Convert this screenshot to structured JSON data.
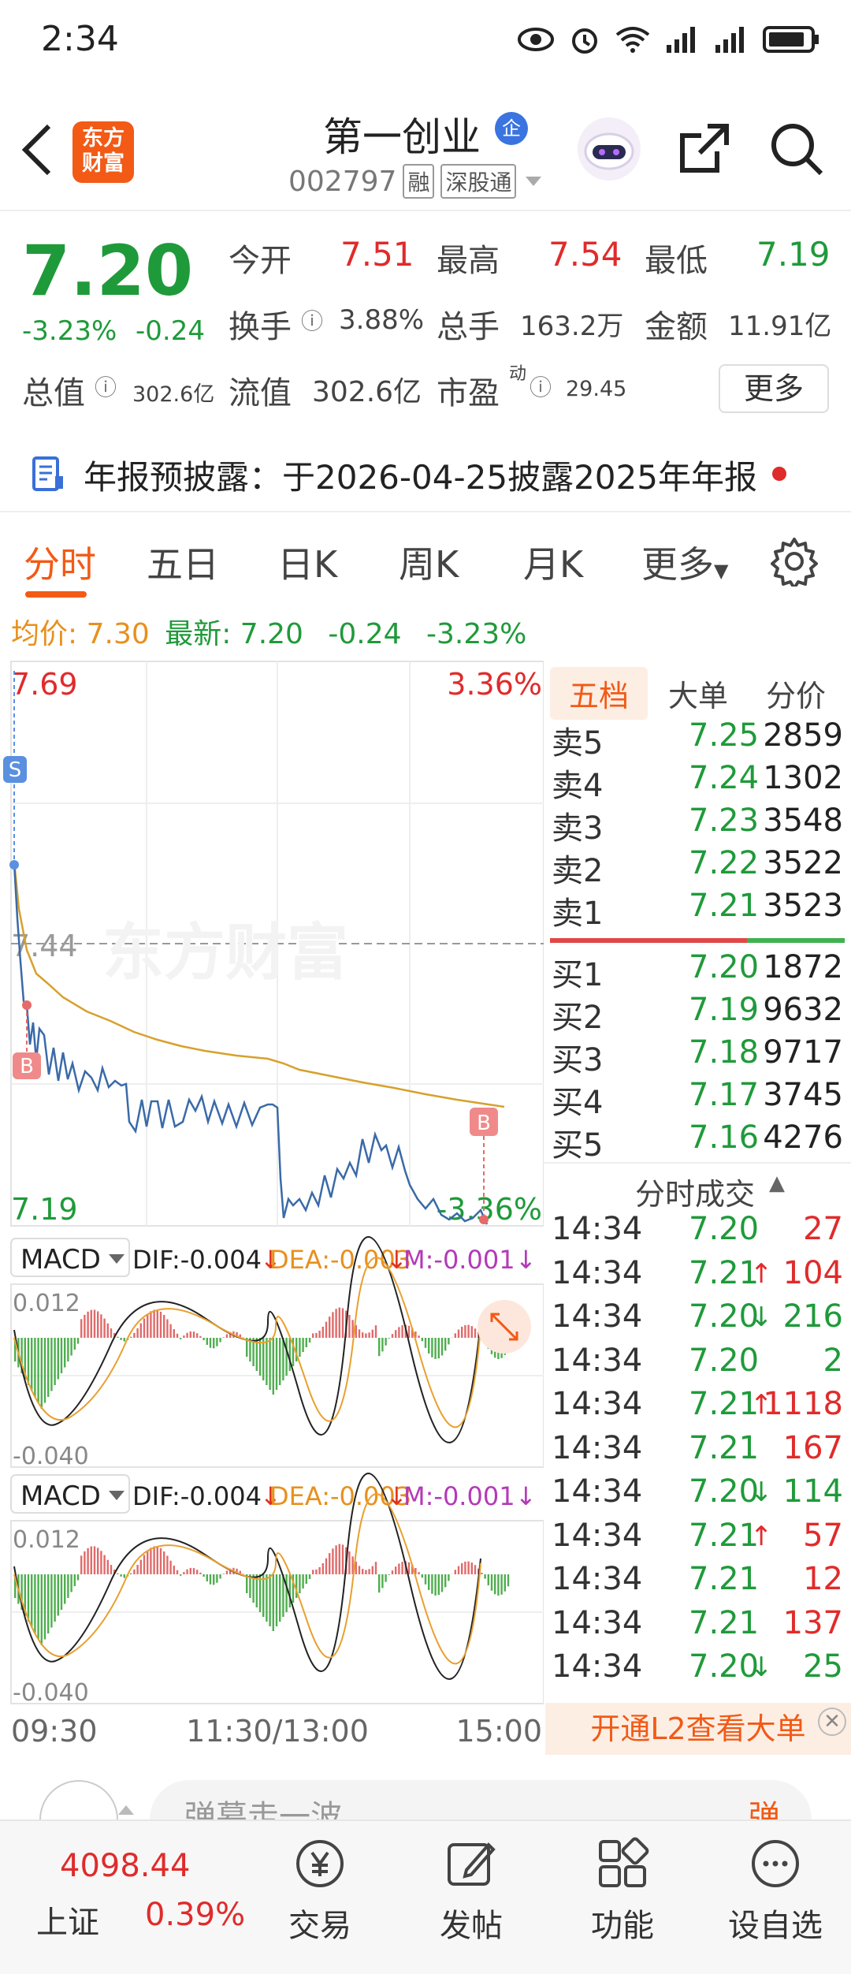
{
  "status_bar": {
    "time": "2:34"
  },
  "header": {
    "logo_text_1": "东方",
    "logo_text_2": "财富",
    "stock_name": "第一创业",
    "badge": "企",
    "code": "002797",
    "tags": [
      "融",
      "深股通"
    ]
  },
  "quote": {
    "price": "7.20",
    "change_pct": "-3.23%",
    "change": "-0.24",
    "open_label": "今开",
    "open": "7.51",
    "high_label": "最高",
    "high": "7.54",
    "low_label": "最低",
    "low": "7.19",
    "turnover_label": "换手",
    "turnover": "3.88%",
    "volume_label": "总手",
    "volume": "163.2万",
    "amount_label": "金额",
    "amount": "11.91亿",
    "mktcap_label": "总值",
    "mktcap": "302.6亿",
    "float_label": "流值",
    "float": "302.6亿",
    "pe_label": "市盈",
    "pe_sup": "动",
    "pe": "29.45",
    "more": "更多"
  },
  "notice": {
    "text": "年报预披露：于2026-04-25披露2025年年报"
  },
  "tabs": [
    "分时",
    "五日",
    "日K",
    "周K",
    "月K",
    "更多"
  ],
  "avg_bar": {
    "avg_label": "均价:",
    "avg": "7.30",
    "latest_label": "最新:",
    "latest": "7.20",
    "chg": "-0.24",
    "pct": "-3.23%"
  },
  "chart": {
    "y_top": "7.69",
    "y_top_pct": "3.36%",
    "y_mid": "7.44",
    "y_bottom": "7.19",
    "y_bottom_pct": "-3.36%",
    "watermark": "东方财富",
    "macd1": {
      "name": "MACD",
      "dif": "DIF:-0.004",
      "dea": "DEA:-0.003",
      "m": "M:-0.001",
      "top": "0.012",
      "bottom": "-0.040"
    },
    "macd2": {
      "name": "MACD",
      "dif": "DIF:-0.004",
      "dea": "DEA:-0.003",
      "m": "M:-0.001",
      "top": "0.012",
      "bottom": "-0.040"
    },
    "x_labels": [
      "09:30",
      "11:30/13:00",
      "15:00"
    ],
    "marker_s": "S",
    "marker_b": "B"
  },
  "order_book": {
    "tabs": [
      "五档",
      "大单",
      "分价"
    ],
    "asks": [
      {
        "label": "卖5",
        "price": "7.25",
        "vol": "2859"
      },
      {
        "label": "卖4",
        "price": "7.24",
        "vol": "1302"
      },
      {
        "label": "卖3",
        "price": "7.23",
        "vol": "3548"
      },
      {
        "label": "卖2",
        "price": "7.22",
        "vol": "3522"
      },
      {
        "label": "卖1",
        "price": "7.21",
        "vol": "3523"
      }
    ],
    "bids": [
      {
        "label": "买1",
        "price": "7.20",
        "vol": "1872"
      },
      {
        "label": "买2",
        "price": "7.19",
        "vol": "9632"
      },
      {
        "label": "买3",
        "price": "7.18",
        "vol": "9717"
      },
      {
        "label": "买4",
        "price": "7.17",
        "vol": "3745"
      },
      {
        "label": "买5",
        "price": "7.16",
        "vol": "4276"
      }
    ],
    "ticks_title": "分时成交",
    "ticks": [
      {
        "time": "14:34",
        "price": "7.20",
        "arrow": "",
        "vol": "27",
        "dir": "buy"
      },
      {
        "time": "14:34",
        "price": "7.21",
        "arrow": "↑",
        "vol": "104",
        "dir": "buy"
      },
      {
        "time": "14:34",
        "price": "7.20",
        "arrow": "↓",
        "vol": "216",
        "dir": "sell"
      },
      {
        "time": "14:34",
        "price": "7.20",
        "arrow": "",
        "vol": "2",
        "dir": "sell"
      },
      {
        "time": "14:34",
        "price": "7.21",
        "arrow": "↑",
        "vol": "1118",
        "dir": "buy"
      },
      {
        "time": "14:34",
        "price": "7.21",
        "arrow": "",
        "vol": "167",
        "dir": "buy"
      },
      {
        "time": "14:34",
        "price": "7.20",
        "arrow": "↓",
        "vol": "114",
        "dir": "sell"
      },
      {
        "time": "14:34",
        "price": "7.21",
        "arrow": "↑",
        "vol": "57",
        "dir": "buy"
      },
      {
        "time": "14:34",
        "price": "7.21",
        "arrow": "",
        "vol": "12",
        "dir": "buy"
      },
      {
        "time": "14:34",
        "price": "7.21",
        "arrow": "",
        "vol": "137",
        "dir": "buy"
      },
      {
        "time": "14:34",
        "price": "7.20",
        "arrow": "↓",
        "vol": "25",
        "dir": "sell"
      }
    ],
    "l2_banner": "开通L2查看大单"
  },
  "comment": {
    "placeholder": "弹幕走一波",
    "send": "弹"
  },
  "nav": {
    "index_value": "4098.44",
    "index_name": "上证",
    "index_pct": "0.39%",
    "items": [
      "交易",
      "发帖",
      "功能",
      "设自选"
    ]
  }
}
